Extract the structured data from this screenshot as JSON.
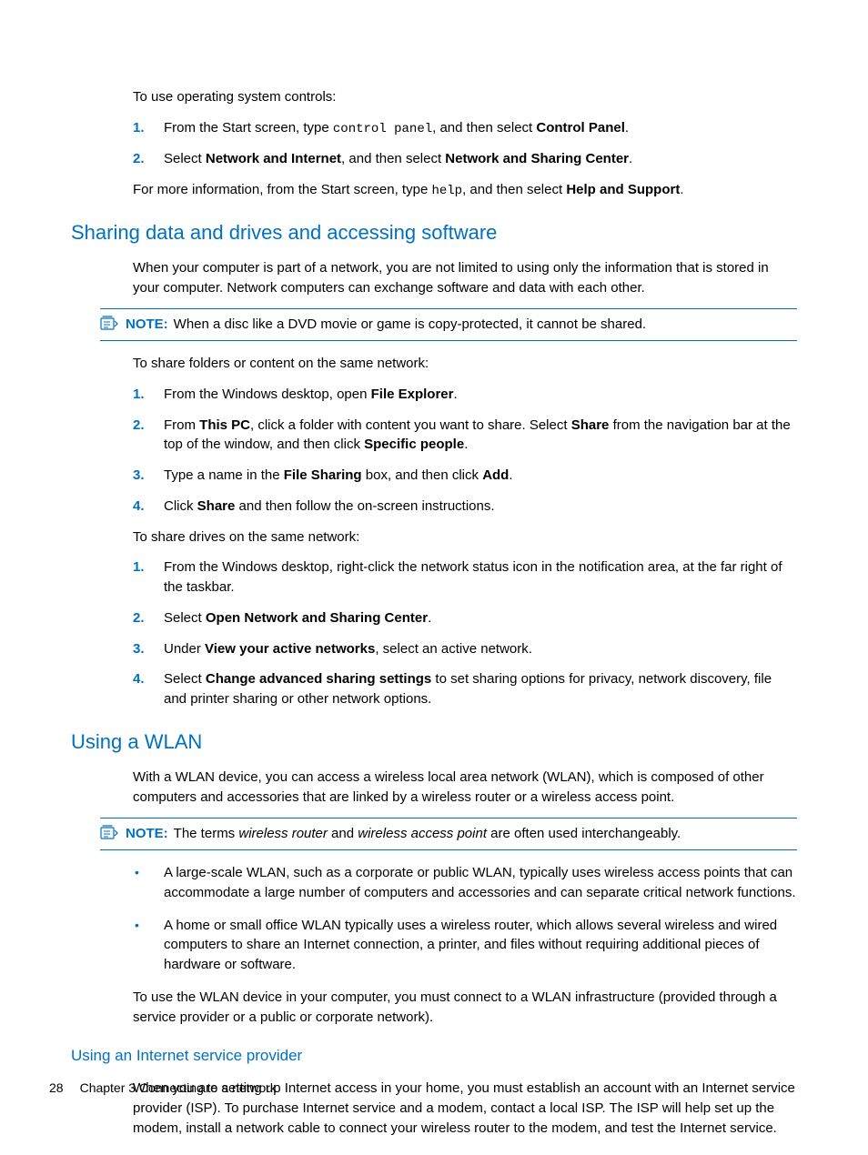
{
  "intro": {
    "p1": "To use operating system controls:",
    "steps": [
      {
        "pre": "From the Start screen, type ",
        "code": "control panel",
        "mid": ", and then select ",
        "b1": "Control Panel",
        "post": "."
      },
      {
        "pre": "Select ",
        "b1": "Network and Internet",
        "mid": ", and then select ",
        "b2": "Network and Sharing Center",
        "post": "."
      }
    ],
    "p2_pre": "For more information, from the Start screen, type ",
    "p2_code": "help",
    "p2_mid": ", and then select ",
    "p2_b": "Help and Support",
    "p2_post": "."
  },
  "sharing": {
    "heading": "Sharing data and drives and accessing software",
    "p1": "When your computer is part of a network, you are not limited to using only the information that is stored in your computer. Network computers can exchange software and data with each other.",
    "note_label": "NOTE:",
    "note_text": "When a disc like a DVD movie or game is copy-protected, it cannot be shared.",
    "p2": "To share folders or content on the same network:",
    "folders_steps": [
      {
        "pre": "From the Windows desktop, open ",
        "b1": "File Explorer",
        "post": "."
      },
      {
        "pre": "From ",
        "b1": "This PC",
        "mid": ", click a folder with content you want to share. Select ",
        "b2": "Share",
        "mid2": " from the navigation bar at the top of the window, and then click ",
        "b3": "Specific people",
        "post": "."
      },
      {
        "pre": "Type a name in the ",
        "b1": "File Sharing",
        "mid": " box, and then click ",
        "b2": "Add",
        "post": "."
      },
      {
        "pre": "Click ",
        "b1": "Share",
        "post": " and then follow the on-screen instructions."
      }
    ],
    "p3": "To share drives on the same network:",
    "drives_steps": [
      {
        "text": "From the Windows desktop, right-click the network status icon in the notification area, at the far right of the taskbar."
      },
      {
        "pre": "Select ",
        "b1": "Open Network and Sharing Center",
        "post": "."
      },
      {
        "pre": "Under ",
        "b1": "View your active networks",
        "post": ", select an active network."
      },
      {
        "pre": "Select ",
        "b1": "Change advanced sharing settings",
        "post": " to set sharing options for privacy, network discovery, file and printer sharing or other network options."
      }
    ]
  },
  "wlan": {
    "heading": "Using a WLAN",
    "p1": "With a WLAN device, you can access a wireless local area network (WLAN), which is composed of other computers and accessories that are linked by a wireless router or a wireless access point.",
    "note_label": "NOTE:",
    "note_pre": "The terms ",
    "note_i1": "wireless router",
    "note_mid": " and ",
    "note_i2": "wireless access point",
    "note_post": " are often used interchangeably.",
    "bullets": [
      "A large-scale WLAN, such as a corporate or public WLAN, typically uses wireless access points that can accommodate a large number of computers and accessories and can separate critical network functions.",
      "A home or small office WLAN typically uses a wireless router, which allows several wireless and wired computers to share an Internet connection, a printer, and files without requiring additional pieces of hardware or software."
    ],
    "p2": "To use the WLAN device in your computer, you must connect to a WLAN infrastructure (provided through a service provider or a public or corporate network)."
  },
  "isp": {
    "heading": "Using an Internet service provider",
    "p1": "When you are setting up Internet access in your home, you must establish an account with an Internet service provider (ISP). To purchase Internet service and a modem, contact a local ISP. The ISP will help set up the modem, install a network cable to connect your wireless router to the modem, and test the Internet service."
  },
  "footer": {
    "page": "28",
    "chapter": "Chapter 3   Connecting to a network"
  }
}
